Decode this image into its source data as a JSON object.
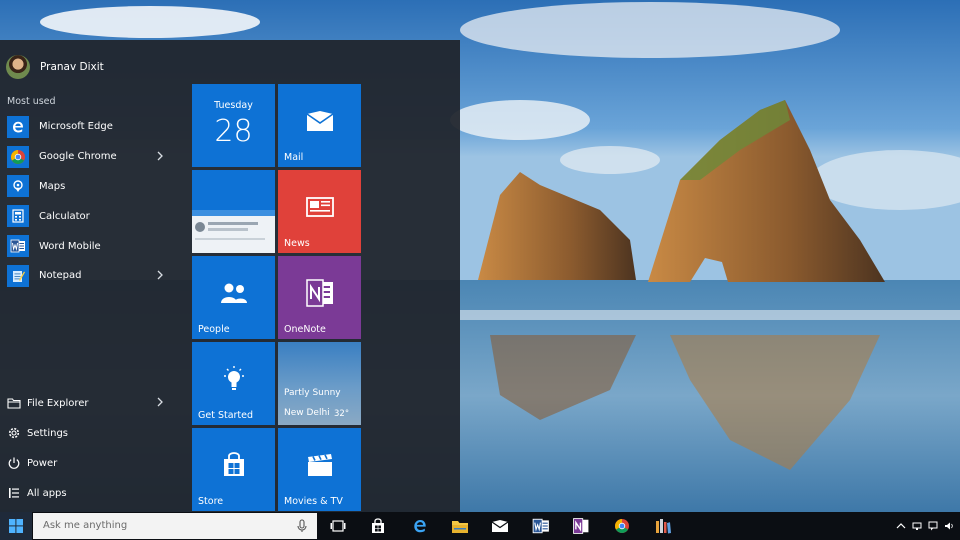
{
  "user": {
    "name": "Pranav Dixit"
  },
  "start_menu": {
    "most_used_label": "Most used",
    "apps": [
      {
        "label": "Microsoft Edge",
        "icon": "edge-icon",
        "has_submenu": false
      },
      {
        "label": "Google Chrome",
        "icon": "chrome-icon",
        "has_submenu": true
      },
      {
        "label": "Maps",
        "icon": "maps-icon",
        "has_submenu": false
      },
      {
        "label": "Calculator",
        "icon": "calculator-icon",
        "has_submenu": false
      },
      {
        "label": "Word Mobile",
        "icon": "word-icon",
        "has_submenu": false
      },
      {
        "label": "Notepad",
        "icon": "notepad-icon",
        "has_submenu": true
      }
    ],
    "bottom": [
      {
        "label": "File Explorer",
        "icon": "folder-icon",
        "has_submenu": true
      },
      {
        "label": "Settings",
        "icon": "gear-icon"
      },
      {
        "label": "Power",
        "icon": "power-icon"
      },
      {
        "label": "All apps",
        "icon": "list-icon"
      }
    ]
  },
  "tiles": {
    "calendar": {
      "day": "Tuesday",
      "date": "28"
    },
    "mail": {
      "label": "Mail"
    },
    "news": {
      "label": "News"
    },
    "people": {
      "label": "People"
    },
    "onenote": {
      "label": "OneNote"
    },
    "get_started": {
      "label": "Get Started"
    },
    "weather": {
      "condition": "Partly Sunny",
      "city": "New Delhi",
      "temp": "32°"
    },
    "store": {
      "label": "Store"
    },
    "movies": {
      "label": "Movies & TV"
    }
  },
  "taskbar": {
    "search_placeholder": "Ask me anything",
    "pinned": [
      "task-view-icon",
      "store-icon",
      "edge-icon",
      "file-explorer-icon",
      "mail-icon",
      "word-icon",
      "onenote-icon",
      "chrome-icon",
      "library-icon"
    ]
  },
  "colors": {
    "accent": "#0e72d5",
    "news": "#e0413a",
    "onenote": "#7b3a96",
    "menu_bg": "#20242c",
    "taskbar_bg": "#0b0e13"
  }
}
